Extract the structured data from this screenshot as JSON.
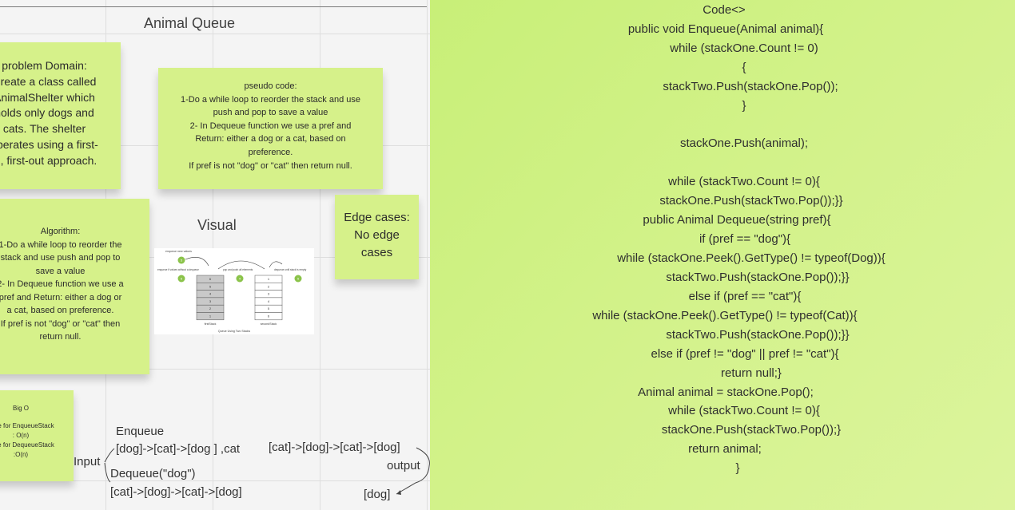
{
  "board": {
    "frame_title": "Animal Queue",
    "visual_title": "Visual"
  },
  "notes": {
    "problem_domain": [
      "problem Domain:",
      "Create a class called",
      "AnimalShelter which",
      "holds only dogs and",
      "cats. The shelter",
      "operates using a first-",
      "in, first-out approach."
    ],
    "pseudo_code": [
      "pseudo code:",
      "1-Do a while loop to reorder the stack and use",
      "push and pop to save a value",
      "2- In Dequeue function we use a pref and",
      "Return: either a dog or a cat, based on",
      "preference.",
      "If pref is not \"dog\" or \"cat\" then return null."
    ],
    "algorithm": [
      "Algorithm:",
      "1-Do a while loop to reorder the",
      "stack and use push and pop to",
      "save a value",
      "2- In Dequeue function we use a",
      "pref and Return: either a dog or",
      "a cat, based on preference.",
      "If pref is not \"dog\" or \"cat\" then",
      "return null."
    ],
    "edge_cases": [
      "Edge cases:",
      "No edge",
      "cases"
    ],
    "big_o": {
      "title": "Big O",
      "lines": [
        "Time for EnqueueStack",
        ": O(n)",
        "Time for DequeueStack",
        ":O(n)"
      ]
    }
  },
  "visual": {
    "top_label": "enqueue new values",
    "left_label": "enqueue if values without a dequeue",
    "mid_label": "pop and push all elements",
    "right_label": "dequeue until stack is empty",
    "stack_one_label": "firstStack",
    "stack_two_label": "secondStack",
    "caption": "Queue Using Two Stacks",
    "stack_one_values": [
      "6",
      "5",
      "4",
      "3",
      "2",
      "1"
    ],
    "stack_two_values": [
      "1",
      "2",
      "3",
      "4",
      "5",
      "6"
    ],
    "bubbles": [
      "5",
      "6",
      "4",
      "5"
    ]
  },
  "diagram": {
    "enqueue": "Enqueue",
    "enqueue_list": "[dog]->[cat]->[dog ] ,cat",
    "input": "Input",
    "dequeue": "Dequeue(\"dog\")",
    "dequeue_list": "[cat]->[dog]->[cat]->[dog]",
    "output_list": "[cat]->[dog]->[cat]->[dog]",
    "output": "output",
    "output_result": "[dog]"
  },
  "code": [
    "Code<>",
    "public void Enqueue(Animal animal){",
    "while (stackOne.Count != 0)",
    "{",
    "stackTwo.Push(stackOne.Pop());",
    "}",
    "",
    "stackOne.Push(animal);",
    "",
    "while (stackTwo.Count != 0){",
    "stackOne.Push(stackTwo.Pop());}}",
    "public Animal Dequeue(string pref){",
    "if (pref == \"dog\"){",
    "while (stackOne.Peek().GetType() != typeof(Dog)){",
    "stackTwo.Push(stackOne.Pop());}}",
    "else if (pref == \"cat\"){",
    "while (stackOne.Peek().GetType() != typeof(Cat)){",
    "stackTwo.Push(stackOne.Pop());}}",
    "else if (pref != \"dog\" || pref != \"cat\"){",
    "return null;}",
    "Animal animal = stackOne.Pop();",
    "while (stackTwo.Count != 0){",
    "stackOne.Push(stackTwo.Pop());}",
    "return animal;",
    "}"
  ],
  "colors": {
    "sticky": "#d6f18a",
    "code_panel": "#d2f289",
    "bubble": "#8bc34a"
  }
}
